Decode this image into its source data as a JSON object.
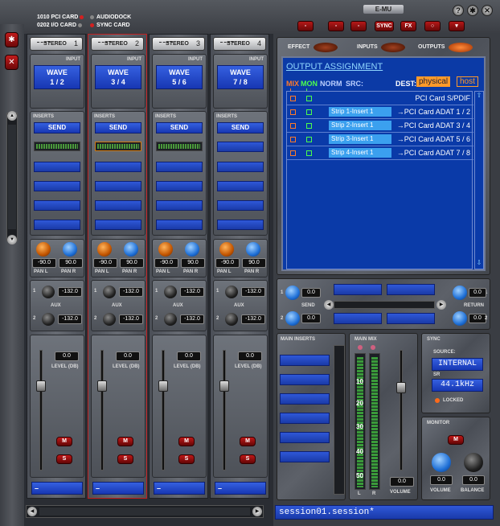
{
  "header": {
    "cards": [
      "1010 PCI CARD",
      "0202 I/O CARD"
    ],
    "docks": [
      "AUDIODOCK",
      "SYNC CARD"
    ],
    "brand": "E-MU",
    "toolbar": [
      "▫",
      "▫",
      "▫",
      "SYNC",
      "FX",
      "○",
      "▾"
    ],
    "window_buttons": [
      "?",
      "✱",
      "✕"
    ]
  },
  "left_buttons": [
    "✱",
    "✕"
  ],
  "strips": [
    {
      "title": "STEREO",
      "num": "1",
      "input": "WAVE\n1 / 2",
      "send": "SEND",
      "pan_l": "-90.0",
      "pan_r": "90.0",
      "aux1": "-132.0",
      "aux2": "-132.0",
      "level": "0.0",
      "mute": "M",
      "solo": "S",
      "footer": "–"
    },
    {
      "title": "STEREO",
      "num": "2",
      "input": "WAVE\n3 / 4",
      "send": "SEND",
      "pan_l": "-90.0",
      "pan_r": "90.0",
      "aux1": "-132.0",
      "aux2": "-132.0",
      "level": "0.0",
      "mute": "M",
      "solo": "S",
      "footer": "–"
    },
    {
      "title": "STEREO",
      "num": "3",
      "input": "WAVE\n5 / 6",
      "send": "SEND",
      "pan_l": "-90.0",
      "pan_r": "90.0",
      "aux1": "-132.0",
      "aux2": "-132.0",
      "level": "0.0",
      "mute": "M",
      "solo": "S",
      "footer": "–"
    },
    {
      "title": "STEREO",
      "num": "4",
      "input": "WAVE\n7 / 8",
      "send": "SEND",
      "pan_l": "-90.0",
      "pan_r": "90.0",
      "aux1": "-132.0",
      "aux2": "-132.0",
      "level": "0.0",
      "mute": "M",
      "solo": "S",
      "footer": "–"
    }
  ],
  "strip_labels": {
    "input": "INPUT",
    "inserts": "INSERTS",
    "pan_l": "PAN L",
    "pan_r": "PAN R",
    "aux": "AUX",
    "level": "LEVEL (DB)",
    "aux_n1": "1",
    "aux_n2": "2"
  },
  "tabs": {
    "effect": "EFFECT",
    "inputs": "INPUTS",
    "outputs": "OUTPUTS"
  },
  "routing": {
    "title": "OUTPUT ASSIGNMENT",
    "col_mix": "MIX",
    "col_mon": "MON",
    "col_norm": "NORM",
    "col_src": "SRC:",
    "dest_label": "DEST:",
    "dest_physical": "physical",
    "dest_host": "host",
    "rows": [
      {
        "src": "",
        "dest": "PCI Card S/PDIF"
      },
      {
        "src": "Strip 1-Insert 1",
        "dest": "→PCI Card ADAT 1 / 2"
      },
      {
        "src": "Strip 2-Insert 1",
        "dest": "→PCI Card ADAT 3 / 4"
      },
      {
        "src": "Strip 3-Insert 1",
        "dest": "→PCI Card ADAT 5 / 6"
      },
      {
        "src": "Strip 4-Insert 1",
        "dest": "→PCI Card ADAT 7 / 8"
      }
    ]
  },
  "fx": {
    "send_label": "SEND",
    "return_label": "RETURN",
    "s1": "0.0",
    "s2": "0.0",
    "r1": "0.0",
    "r2": "0.0",
    "n1": "1",
    "n2": "2"
  },
  "main_inserts": {
    "label": "MAIN INSERTS"
  },
  "main_mix": {
    "label": "MAIN MIX",
    "ticks": [
      "10",
      "20",
      "30",
      "40",
      "50"
    ],
    "l": "L",
    "r": "R",
    "volume_val": "0.0",
    "volume_label": "VOLUME"
  },
  "sync": {
    "label": "SYNC",
    "source_label": "SOURCE:",
    "source": "INTERNAL",
    "sr_label": "SR",
    "sr": "44.1kHz",
    "locked": "LOCKED"
  },
  "monitor": {
    "label": "MONITOR",
    "mute": "M",
    "vol": "0.0",
    "bal": "0.0",
    "vol_label": "VOLUME",
    "bal_label": "BALANCE"
  },
  "session": {
    "name": "session01.session*"
  }
}
